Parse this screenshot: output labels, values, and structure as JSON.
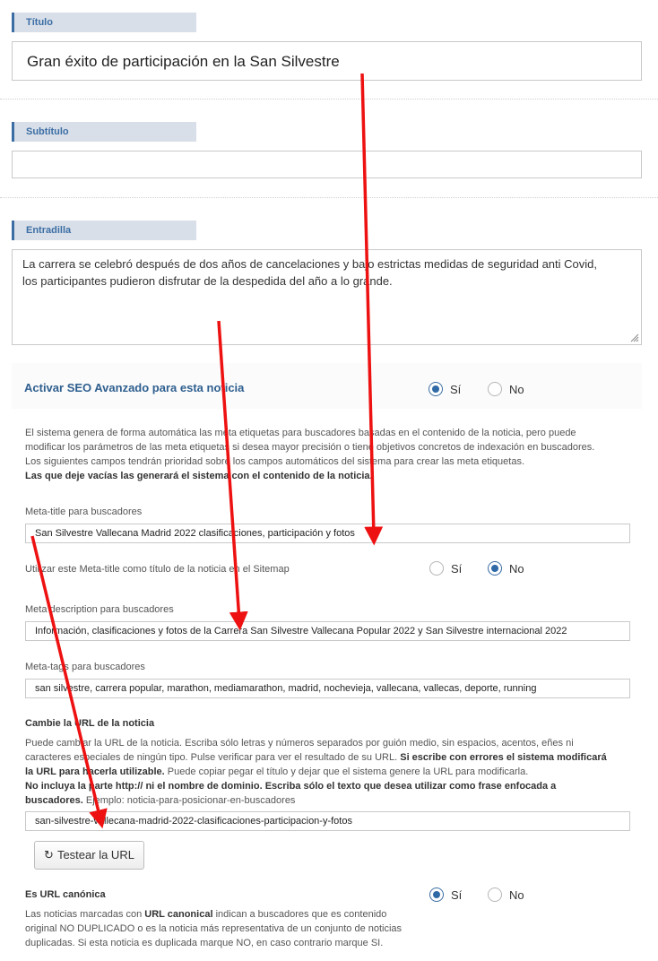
{
  "titulo": {
    "label": "Título",
    "value": "Gran éxito de participación en la San Silvestre"
  },
  "subtitulo": {
    "label": "Subtítulo",
    "value": ""
  },
  "entradilla": {
    "label": "Entradilla",
    "line1": "La carrera se celebró después de dos años de cancelaciones y bajo estrictas medidas de seguridad anti Covid,",
    "line2": "los participantes pudieron disfrutar de la despedida del año a lo grande."
  },
  "seo": {
    "title": "Activar SEO Avanzado para esta noticia",
    "yes": "Sí",
    "no": "No",
    "selected": "Sí",
    "intro": {
      "l1": "El sistema genera de forma automática las meta etiquetas para buscadores basadas en el contenido de la noticia, pero puede",
      "l2": "modificar los parámetros de las meta etiquetas si desea mayor precisión o tiene objetivos concretos de indexación en buscadores.",
      "l3": "Los siguientes campos tendrán prioridad sobre los campos automáticos del sistema para crear las meta etiquetas.",
      "l4": "Las que deje vacías las generará el sistema con el contenido de la noticia."
    },
    "meta_title": {
      "label": "Meta-title para buscadores",
      "value": "San Silvestre Vallecana Madrid 2022 clasificaciones, participación y fotos"
    },
    "sitemap": {
      "label": "Utilizar este Meta-title como título de la noticia en el Sitemap",
      "yes": "Sí",
      "no": "No",
      "selected": "No"
    },
    "meta_description": {
      "label": "Meta description para buscadores",
      "value": "Información, clasificaciones y fotos de la Carrera San Silvestre Vallecana Popular 2022 y San Silvestre internacional 2022"
    },
    "meta_tags": {
      "label": "Meta-tags para buscadores",
      "value": "san silvestre, carrera popular, marathon, mediamarathon, madrid, nochevieja, vallecana, vallecas, deporte, running"
    },
    "url": {
      "label": "Cambie la URL de la noticia",
      "h1": "Puede cambiar la URL de la noticia. Escriba sólo letras y números separados por guión medio, sin espacios, acentos, eñes ni",
      "h2a": "caracteres especiales de ningún tipo. Pulse verificar para ver el resultado de su URL. ",
      "h2b": "Si escribe con errores el sistema modificará",
      "h3a": "la URL para hacerla utilizable.",
      "h3b": " Puede copiar pegar el título y dejar que el sistema genere la URL para modificarla.",
      "h4": "No incluya la parte http:// ni el nombre de dominio. Escriba sólo el texto que desea utilizar como frase enfocada a",
      "h5a": "buscadores.",
      "h5b": " Ejemplo: noticia-para-posicionar-en-buscadores",
      "value": "san-silvestre-vallecana-madrid-2022-clasificaciones-participacion-y-fotos",
      "test_button": "Testear la URL"
    },
    "canonical": {
      "label": "Es URL canónica",
      "yes": "Sí",
      "no": "No",
      "selected": "Sí",
      "d1a": "Las noticias marcadas con ",
      "d1b": "URL canonical",
      "d1c": " indican a buscadores que es contenido",
      "d2": "original NO DUPLICADO o es la noticia más representativa de un conjunto de noticias",
      "d3": "duplicadas. Si esta noticia es duplicada marque NO, en caso contrario marque SI."
    }
  },
  "colors": {
    "arrow": "#ee1111",
    "accent": "#3b6ea5",
    "label_bg": "#d9dfe8"
  },
  "icons": {
    "refresh": "refresh-icon",
    "resize": "resize-handle-icon"
  }
}
